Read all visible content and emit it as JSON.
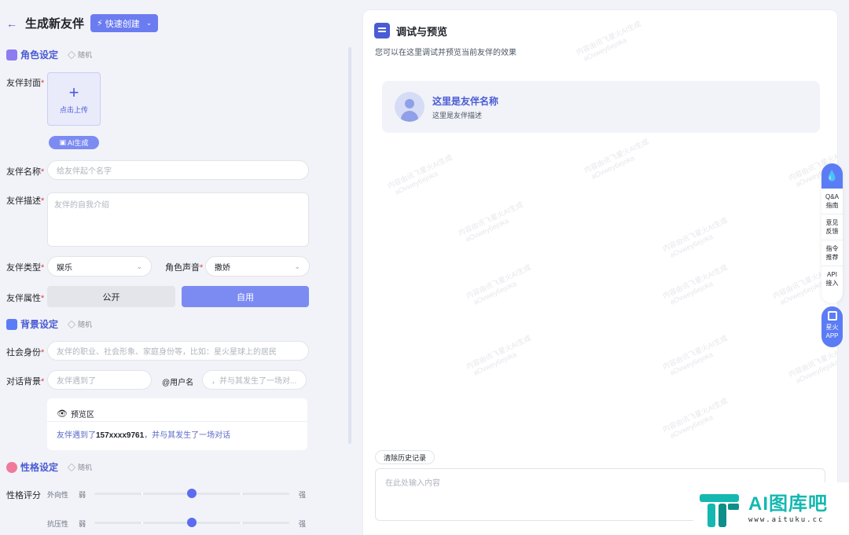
{
  "header": {
    "title": "生成新友伴",
    "quick_create": "快速创建"
  },
  "sections": {
    "role": {
      "title": "角色设定",
      "random": "随机",
      "icon_color": "#8b7cf0"
    },
    "background": {
      "title": "背景设定",
      "random": "随机",
      "icon_color": "#5b7cf5"
    },
    "personality": {
      "title": "性格设定",
      "random": "随机",
      "icon_color": "#f07a9b"
    }
  },
  "form": {
    "cover_label": "友伴封面",
    "upload_text": "点击上传",
    "ai_generate": "AI生成",
    "name_label": "友伴名称",
    "name_placeholder": "给友伴起个名字",
    "desc_label": "友伴描述",
    "desc_placeholder": "友伴的自我介绍",
    "type_label": "友伴类型",
    "type_value": "娱乐",
    "voice_label": "角色声音",
    "voice_value": "撒娇",
    "attr_label": "友伴属性",
    "attr_public": "公开",
    "attr_private": "自用",
    "identity_label": "社会身份",
    "identity_placeholder": "友伴的职业、社会形象、家庭身份等，比如：星火星球上的居民",
    "dialog_label": "对话背景",
    "dialog_placeholder1": "友伴遇到了",
    "dialog_mid": "@用户名",
    "dialog_placeholder2": "，并与其发生了一场对...",
    "preview_title": "预览区",
    "preview_prefix": "友伴遇到了",
    "preview_user": "157xxxx9761",
    "preview_suffix": "，并与其发生了一场对话",
    "score_label": "性格评分",
    "sliders": [
      {
        "name": "外向性",
        "weak": "弱",
        "strong": "强",
        "value": 0.5
      },
      {
        "name": "抗压性",
        "weak": "弱",
        "strong": "强",
        "value": 0.5
      }
    ]
  },
  "preview_panel": {
    "title": "调试与预览",
    "subtitle": "您可以在这里调试并预览当前友伴的效果",
    "companion_name": "这里是友伴名称",
    "companion_desc": "这里是友伴描述",
    "clear_history": "清除历史记录",
    "input_placeholder": "在此处输入内容",
    "watermark_line1": "内容由讯飞星火AI生成",
    "watermark_line2": "aOvwey6ejoka"
  },
  "toolbar": {
    "items": [
      "Q&A\n指南",
      "意见\n反馈",
      "指令\n推荐",
      "API\n接入"
    ],
    "app_label": "星火\nAPP"
  },
  "logo": {
    "main": "AI图库吧",
    "sub": "www.aituku.cc"
  },
  "colors": {
    "accent": "#5b6cf0",
    "teal": "#14b8b0"
  }
}
